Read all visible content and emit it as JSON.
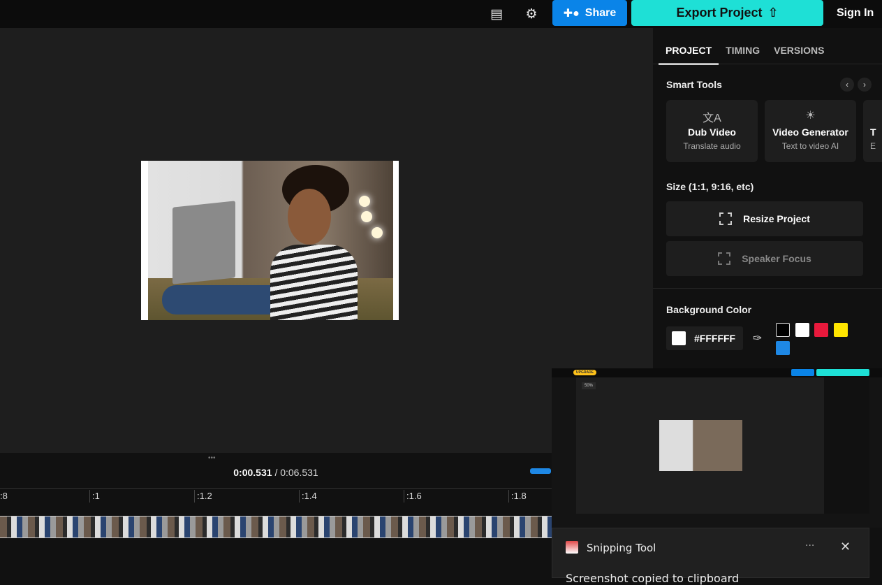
{
  "topbar": {
    "comment_icon": "comment-icon",
    "settings_icon": "gear-icon",
    "share_label": "Share",
    "export_label": "Export Project",
    "signin_label": "Sign In"
  },
  "colors": {
    "share": "#0a84e8",
    "export": "#1ee0d6",
    "background": "#1e1e1e"
  },
  "playback": {
    "current": "0:00.531",
    "total": "/ 0:06.531"
  },
  "ruler": {
    "ticks": [
      ":8",
      ":1",
      ":1.2",
      ":1.4",
      ":1.6",
      ":1.8"
    ]
  },
  "panel": {
    "tabs": [
      "PROJECT",
      "TIMING",
      "VERSIONS"
    ],
    "active_tab": "PROJECT",
    "smart_tools_title": "Smart Tools",
    "tools": [
      {
        "title": "Dub Video",
        "subtitle": "Translate audio",
        "icon": "translate-icon"
      },
      {
        "title": "Video Generator",
        "subtitle": "Text to video AI",
        "icon": "lightbulb-icon"
      },
      {
        "title": "T",
        "subtitle": "E"
      }
    ],
    "size_title": "Size (1:1, 9:16, etc)",
    "resize_label": "Resize Project",
    "speaker_label": "Speaker Focus",
    "bg_title": "Background Color",
    "bg_value": "#FFFFFF",
    "swatches": [
      "#000000",
      "#FFFFFF",
      "#E8193C",
      "#FFE500",
      "#1E88E5"
    ]
  },
  "snip": {
    "upgrade": "UPGRADE",
    "zoom": "50%",
    "title": "Snipping Tool",
    "message": "Screenshot copied to clipboard"
  }
}
